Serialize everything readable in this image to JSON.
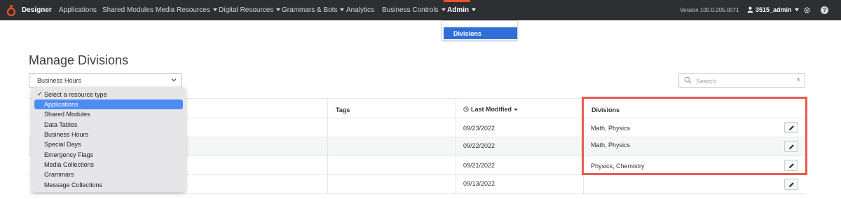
{
  "nav": {
    "brand": "Designer",
    "items": [
      {
        "label": "Applications",
        "dropdown": false
      },
      {
        "label": "Shared Modules",
        "dropdown": false
      },
      {
        "label": "Media Resources",
        "dropdown": true
      },
      {
        "label": "Digital Resources",
        "dropdown": true
      },
      {
        "label": "Grammars & Bots",
        "dropdown": true
      },
      {
        "label": "Analytics",
        "dropdown": false
      },
      {
        "label": "Business Controls",
        "dropdown": true
      },
      {
        "label": "Admin",
        "dropdown": true
      }
    ],
    "version": "Version 100.0.205.0071",
    "user": "3515_admin",
    "accent_color": "#e8542b"
  },
  "admin_menu": {
    "items": [
      "Divisions"
    ]
  },
  "page": {
    "title": "Manage Divisions",
    "resource_select_value": "Business Hours",
    "search_placeholder": "Search",
    "search_clear": "×"
  },
  "resource_popup": {
    "options": [
      {
        "label": "Select a resource type",
        "checked": true
      },
      {
        "label": "Applications",
        "selected": true
      },
      {
        "label": "Shared Modules"
      },
      {
        "label": "Data Tables"
      },
      {
        "label": "Business Hours"
      },
      {
        "label": "Special Days"
      },
      {
        "label": "Emergency Flags"
      },
      {
        "label": "Media Collections"
      },
      {
        "label": "Grammars"
      },
      {
        "label": "Message Collections"
      }
    ]
  },
  "table": {
    "headers": {
      "tags": "Tags",
      "last_modified": "Last Modified",
      "divisions": "Divisions"
    },
    "rows": [
      {
        "last_modified": "09/23/2022",
        "divisions": "Math, Physics"
      },
      {
        "last_modified": "09/22/2022",
        "divisions": "Math, Physics"
      },
      {
        "last_modified": "09/21/2022",
        "divisions": "Physics, Chemistry"
      },
      {
        "last_modified": "09/13/2022",
        "divisions": ""
      }
    ]
  },
  "highlight_color": "#e85a4f"
}
